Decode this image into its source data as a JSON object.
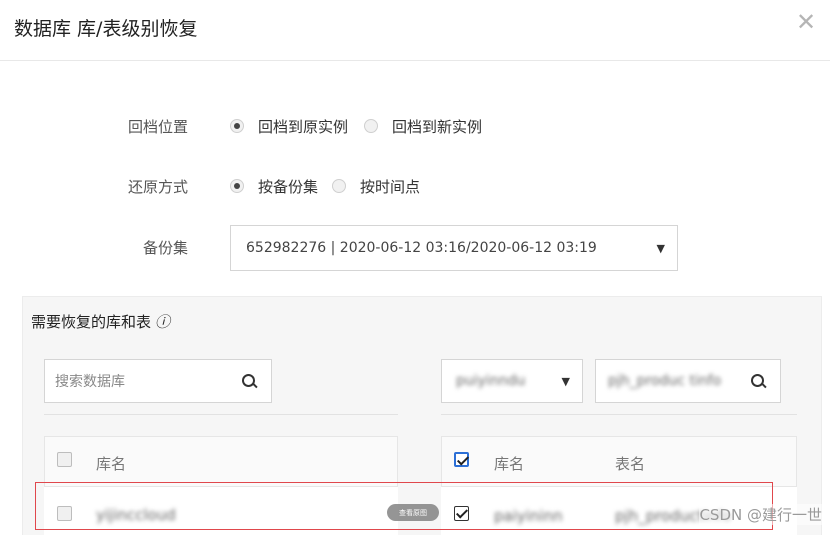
{
  "dialog": {
    "title": "数据库 库/表级别恢复",
    "close_icon": "close-icon"
  },
  "form": {
    "restore_location": {
      "label": "回档位置",
      "options": [
        {
          "label": "回档到原实例",
          "selected": true
        },
        {
          "label": "回档到新实例",
          "selected": false
        }
      ]
    },
    "restore_method": {
      "label": "还原方式",
      "options": [
        {
          "label": "按备份集",
          "selected": true
        },
        {
          "label": "按时间点",
          "selected": false
        }
      ]
    },
    "backup_set": {
      "label": "备份集",
      "value": "652982276 | 2020-06-12 03:16/2020-06-12 03:19",
      "caret": "▼"
    }
  },
  "panel": {
    "title": "需要恢复的库和表",
    "info_icon": "ⓘ",
    "left": {
      "search_placeholder": "搜索数据库",
      "header_db": "库名",
      "rows": [
        {
          "db": "yijinccloud",
          "checked": false
        }
      ]
    },
    "right": {
      "db_select_value": "puiyinndu",
      "db_select_caret": "▼",
      "table_search_value": "pjh_produc tinfo",
      "header_db": "库名",
      "header_table": "表名",
      "header_checked": true,
      "rows": [
        {
          "db": "paiyininn",
          "table": "pjh_productinfo",
          "checked": true
        }
      ]
    }
  },
  "overlay": {
    "view_original_pill": "查看原图",
    "watermark": "CSDN @建行一世"
  }
}
